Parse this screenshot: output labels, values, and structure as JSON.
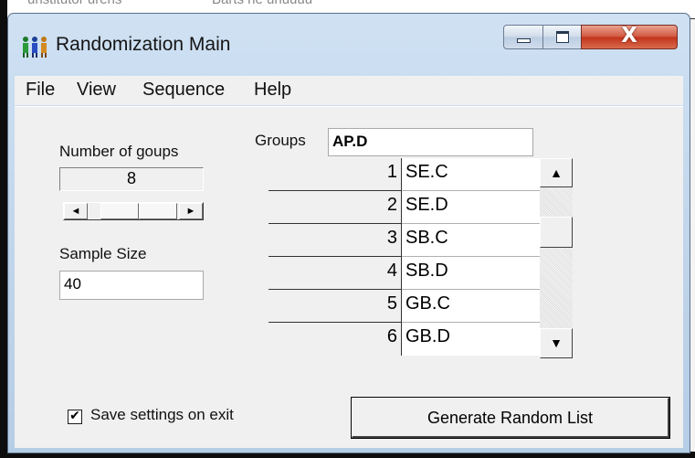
{
  "background_text": [
    "unstitutor urens",
    "Barts he unuuuu"
  ],
  "window": {
    "title": "Randomization Main",
    "icon": "people-icon",
    "controls": {
      "minimize": "minimize-icon",
      "maximize": "maximize-icon",
      "close_glyph": "X"
    }
  },
  "menu": [
    "File",
    "View",
    "Sequence",
    "Help"
  ],
  "left_panel": {
    "groups_count_label": "Number of goups",
    "groups_count_value": "8",
    "scroll_left": "◄",
    "scroll_right": "►",
    "sample_size_label": "Sample Size",
    "sample_size_value": "40"
  },
  "groups": {
    "label": "Groups",
    "current_value": "AP.D",
    "rows": [
      {
        "num": "1",
        "name": "SE.C"
      },
      {
        "num": "2",
        "name": "SE.D"
      },
      {
        "num": "3",
        "name": "SB.C"
      },
      {
        "num": "4",
        "name": "SB.D"
      },
      {
        "num": "5",
        "name": "GB.C"
      },
      {
        "num": "6",
        "name": "GB.D"
      }
    ],
    "scroll_up": "▲",
    "scroll_down": "▼"
  },
  "save_settings": {
    "label": "Save settings on exit",
    "checked": true,
    "mark": "✔"
  },
  "generate_button": "Generate Random List",
  "colors": {
    "window_frame": "#bfd4ea",
    "close_button": "#c3321a",
    "face": "#f0f0f0"
  }
}
